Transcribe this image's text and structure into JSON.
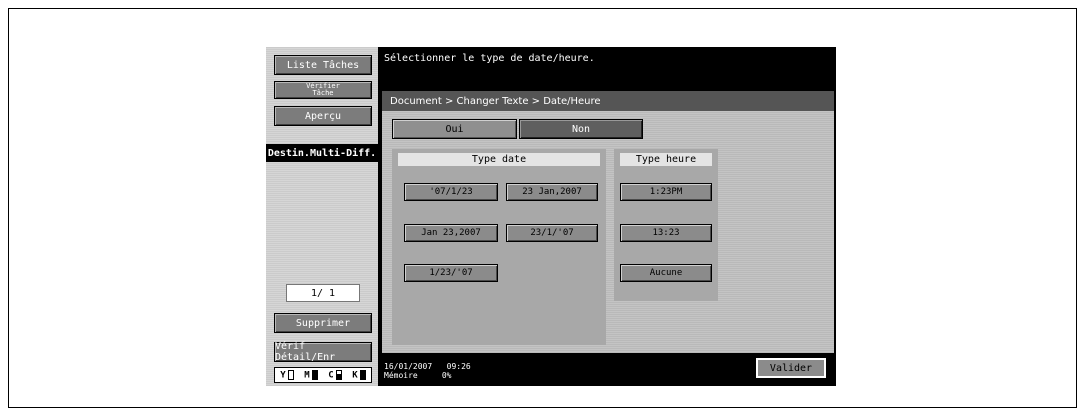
{
  "sidebar": {
    "liste_taches": "Liste Tâches",
    "verifier_tache_line1": "Vérifier",
    "verifier_tache_line2": "Tâche",
    "apercu": "Aperçu",
    "destin": "Destin.Multi-Diff.",
    "counter": "1/ 1",
    "supprimer": "Supprimer",
    "verif_detail": "Vérif Détail/Enr",
    "toner": [
      "Y",
      "M",
      "C",
      "K"
    ]
  },
  "message": "Sélectionner le type de date/heure.",
  "breadcrumb": "Document > Changer Texte > Date/Heure",
  "toggle": {
    "oui": "Oui",
    "non": "Non",
    "selected": "Non"
  },
  "date_group": {
    "title": "Type date",
    "options": [
      "'07/1/23",
      "23 Jan,2007",
      "Jan 23,2007",
      "23/1/'07",
      "1/23/'07"
    ]
  },
  "time_group": {
    "title": "Type heure",
    "options": [
      "1:23PM",
      "13:23",
      "Aucune"
    ]
  },
  "status": {
    "date": "16/01/2007",
    "time": "09:26",
    "memory_label": "Mémoire",
    "memory_value": "0%"
  },
  "valider": "Valider"
}
